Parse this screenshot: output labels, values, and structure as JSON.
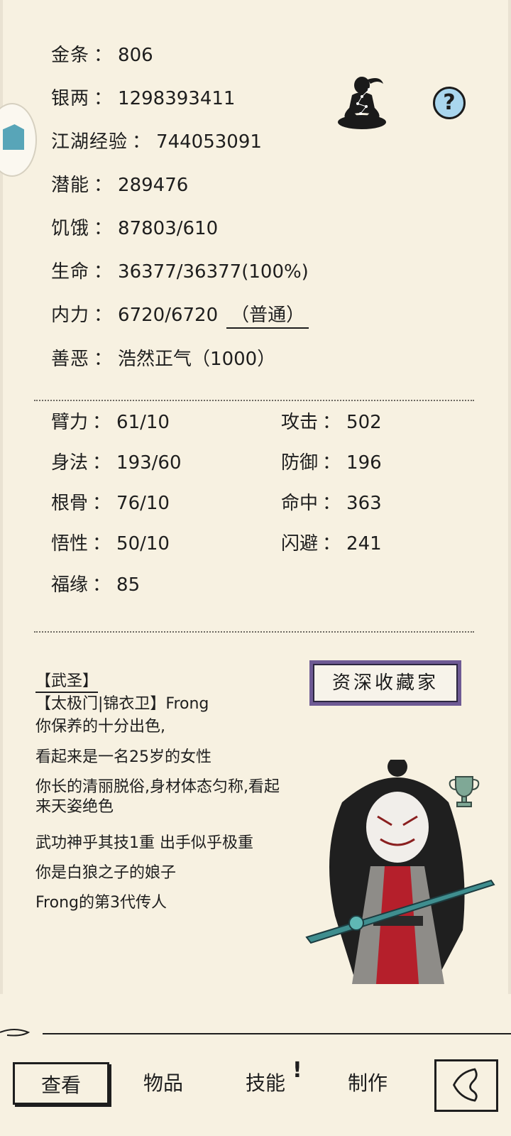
{
  "resources": {
    "gold_bars": {
      "label": "金条",
      "value": "806"
    },
    "silver": {
      "label": "银两",
      "value": "1298393411"
    },
    "jianghu_exp": {
      "label": "江湖经验",
      "value": "744053091"
    },
    "potential": {
      "label": "潜能",
      "value": "289476"
    },
    "hunger": {
      "label": "饥饿",
      "value": "87803/610"
    },
    "hp": {
      "label": "生命",
      "value": "36377/36377(100%)"
    },
    "neili": {
      "label": "内力",
      "value": "6720/6720",
      "mode": "（普通）"
    },
    "morality": {
      "label": "善恶",
      "value": "浩然正气（1000）"
    }
  },
  "separator": "：",
  "attributes": {
    "left": [
      {
        "label": "臂力",
        "value": "61/10"
      },
      {
        "label": "身法",
        "value": "193/60"
      },
      {
        "label": "根骨",
        "value": "76/10"
      },
      {
        "label": "悟性",
        "value": "50/10"
      },
      {
        "label": "福缘",
        "value": "85"
      }
    ],
    "right": [
      {
        "label": "攻击",
        "value": "502"
      },
      {
        "label": "防御",
        "value": "196"
      },
      {
        "label": "命中",
        "value": "363"
      },
      {
        "label": "闪避",
        "value": "241"
      }
    ]
  },
  "profile": {
    "title": "【武圣】",
    "sect_name": "【太极门|锦衣卫】Frong",
    "lines": [
      "你保养的十分出色,",
      "看起来是一名25岁的女性",
      "你长的清丽脱俗,身材体态匀称,看起来天姿绝色",
      "武功神乎其技1重 出手似乎极重",
      "你是白狼之子的娘子",
      "Frong的第3代传人"
    ],
    "badge": "资深收藏家"
  },
  "nav": {
    "tabs": [
      {
        "label": "查看",
        "active": true
      },
      {
        "label": "物品",
        "active": false
      },
      {
        "label": "技能",
        "active": false,
        "alert": "!"
      },
      {
        "label": "制作",
        "active": false
      }
    ]
  },
  "colors": {
    "background": "#f7f1e1",
    "help_icon": "#a9d6ee",
    "plaque": "#6e5a94",
    "trophy": "#6f9a88"
  },
  "icons": [
    "meditate-icon",
    "help-icon",
    "trophy-icon",
    "back-icon"
  ]
}
